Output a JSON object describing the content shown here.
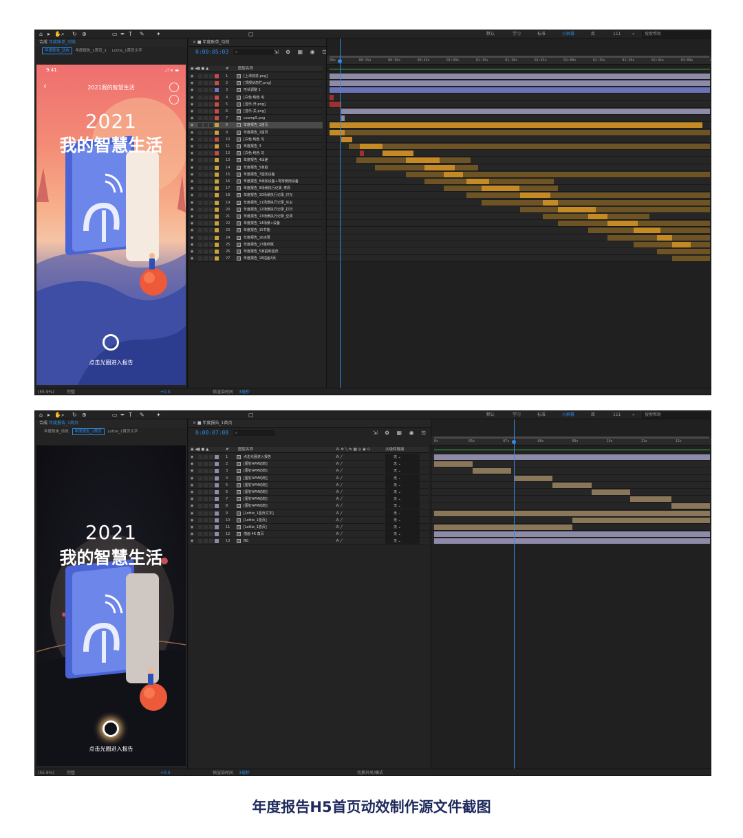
{
  "toolbar": {
    "workspaces": [
      "默认",
      "学习",
      "标准",
      "小屏幕",
      "库",
      "111"
    ],
    "active_workspace": "小屏幕",
    "search_placeholder": "搜索帮助",
    "more": "»"
  },
  "shot1": {
    "panel_title": "合成",
    "panel_comp": "年度账单_动效",
    "breadcrumbs": [
      "年度账单_动效",
      "年度报告_1首页_1",
      "Lottie_1首页文字"
    ],
    "active_crumb": 0,
    "phone": {
      "time": "9:41",
      "signal": "..ıl ᯤ ▬",
      "back": "‹",
      "title": "2021我的智慧生活",
      "year": "2021",
      "headline": "我的智慧生活",
      "cta": "点击光圈进入报告"
    },
    "footer": {
      "zoom": "(55.9%)",
      "quality": "完整",
      "exposure": "+0.0",
      "render_time_label": "帧渲染时间",
      "render_time": "3毫秒"
    },
    "timeline": {
      "tab": "年度账单_动效",
      "timecode": "0:00:05:03",
      "col_layer_name": "图层名称",
      "ticks": [
        "00s",
        "00:15s",
        "00:30s",
        "00:45s",
        "01:00s",
        "01:15s",
        "01:30s",
        "01:45s",
        "02:00s",
        "02:15s",
        "02:30s",
        "02:45s",
        "03:00s",
        "03:15s"
      ],
      "playhead": 0.027,
      "layers": [
        {
          "n": "1",
          "name": "[上滑前进.png]",
          "color": "#c84b4b",
          "icon": "img",
          "bar": [
            0.0,
            1.0
          ],
          "bc": "lav"
        },
        {
          "n": "2",
          "name": "[顶部状态栏.png]",
          "color": "#c84b4b",
          "icon": "img",
          "bar": [
            0.0,
            1.0
          ],
          "bc": "lav"
        },
        {
          "n": "3",
          "name": "形状调整 1",
          "color": "#6e74c8",
          "icon": "shape",
          "bar": [
            0.0,
            1.0
          ],
          "bc": "blue"
        },
        {
          "n": "4",
          "name": "[白色 纯色 4]",
          "color": "#c84b4b",
          "icon": "solid",
          "bar": [
            0.0,
            0.01
          ],
          "bc": "red"
        },
        {
          "n": "5",
          "name": "[音乐-开.png]",
          "color": "#c84b4b",
          "icon": "img",
          "bar": [
            0.0,
            0.03
          ],
          "bc": "red"
        },
        {
          "n": "6",
          "name": "[音乐-关.png]",
          "color": "#c84b4b",
          "icon": "img",
          "bar": [
            0.03,
            1.0
          ],
          "bc": "lav"
        },
        {
          "n": "7",
          "name": "ceamp5.png",
          "color": "#c84b4b",
          "icon": "img",
          "bar": [
            0.03,
            0.04
          ],
          "bc": "lav"
        },
        {
          "n": "8",
          "name": "年度报告_1首页",
          "color": "#c8a23c",
          "icon": "comp",
          "bar": [
            0.0,
            0.98
          ],
          "bc": "gold",
          "sel": true
        },
        {
          "n": "9",
          "name": "年度报告_2首页",
          "color": "#c8a23c",
          "icon": "comp",
          "bar": [
            0.02,
            1.0
          ],
          "bc": "goldd"
        },
        {
          "n": "10",
          "name": "[白色 纯色 3]",
          "color": "#c84b4b",
          "icon": "solid",
          "bar": [
            0.05,
            0.06
          ],
          "bc": "red"
        },
        {
          "n": "11",
          "name": "年度报告_3",
          "color": "#c8a23c",
          "icon": "comp",
          "bar": [
            0.05,
            1.0
          ],
          "bc": "goldd"
        },
        {
          "n": "12",
          "name": "[白色 纯色 2]",
          "color": "#c84b4b",
          "icon": "solid",
          "bar": [
            0.08,
            0.09
          ],
          "bc": "red"
        },
        {
          "n": "13",
          "name": "年度报告_4出差",
          "color": "#c8a23c",
          "icon": "comp",
          "bar": [
            0.07,
            0.37
          ],
          "bc": "goldd"
        },
        {
          "n": "14",
          "name": "年度报告_5家庭",
          "color": "#c8a23c",
          "icon": "comp",
          "bar": [
            0.12,
            0.39
          ],
          "bc": "goldd"
        },
        {
          "n": "15",
          "name": "年度报告_7固定设备",
          "color": "#c8a23c",
          "icon": "comp",
          "bar": [
            0.2,
            1.0
          ],
          "bc": "goldd"
        },
        {
          "n": "16",
          "name": "年度报告_8添加设备+将常使用设备",
          "color": "#c8a23c",
          "icon": "comp",
          "bar": [
            0.25,
            0.59
          ],
          "bc": "goldd"
        },
        {
          "n": "17",
          "name": "年度报告_9场景执行记录_寿辰",
          "color": "#c8a23c",
          "icon": "comp",
          "bar": [
            0.3,
            0.6
          ],
          "bc": "goldd"
        },
        {
          "n": "18",
          "name": "年度报告_10场景执行记录_灯光",
          "color": "#c8a23c",
          "icon": "comp",
          "bar": [
            0.36,
            1.0
          ],
          "bc": "goldd"
        },
        {
          "n": "19",
          "name": "年度报告_11场景执行记录_灰尘",
          "color": "#c8a23c",
          "icon": "comp",
          "bar": [
            0.4,
            1.0
          ],
          "bc": "goldd"
        },
        {
          "n": "20",
          "name": "年度报告_12场景执行记录_打扫",
          "color": "#c8a23c",
          "icon": "comp",
          "bar": [
            0.5,
            1.0
          ],
          "bc": "goldd"
        },
        {
          "n": "21",
          "name": "年度报告_13场景执行记录_空调",
          "color": "#c8a23c",
          "icon": "comp",
          "bar": [
            0.56,
            0.84
          ],
          "bc": "goldd"
        },
        {
          "n": "22",
          "name": "年度报告_14场景+设备",
          "color": "#c8a23c",
          "icon": "comp",
          "bar": [
            0.6,
            1.0
          ],
          "bc": "goldd"
        },
        {
          "n": "23",
          "name": "年度报告_15节能",
          "color": "#c8a23c",
          "icon": "comp",
          "bar": [
            0.68,
            1.0
          ],
          "bc": "goldd"
        },
        {
          "n": "24",
          "name": "年度报告_16点赞",
          "color": "#c8a23c",
          "icon": "comp",
          "bar": [
            0.73,
            1.0
          ],
          "bc": "goldd"
        },
        {
          "n": "25",
          "name": "年度报告_17最终赋",
          "color": "#c8a23c",
          "icon": "comp",
          "bar": [
            0.8,
            1.0
          ],
          "bc": "goldd"
        },
        {
          "n": "26",
          "name": "年度报告_5家庭和首页",
          "color": "#c8a23c",
          "icon": "comp",
          "bar": [
            0.86,
            1.0
          ],
          "bc": "goldd"
        },
        {
          "n": "27",
          "name": "年度报告_18插画3页",
          "color": "#c8a23c",
          "icon": "comp",
          "bar": [
            0.9,
            1.0
          ],
          "bc": "goldd"
        }
      ],
      "gold_segments": [
        [
          0.0,
          0.04
        ],
        [
          0.03,
          0.06
        ],
        [
          0.08,
          0.14
        ],
        [
          0.14,
          0.22
        ],
        [
          0.2,
          0.29
        ],
        [
          0.25,
          0.33
        ],
        [
          0.3,
          0.35
        ],
        [
          0.36,
          0.42
        ],
        [
          0.4,
          0.5
        ],
        [
          0.5,
          0.58
        ],
        [
          0.56,
          0.6
        ],
        [
          0.6,
          0.7
        ],
        [
          0.68,
          0.73
        ],
        [
          0.73,
          0.81
        ],
        [
          0.8,
          0.87
        ],
        [
          0.86,
          0.9
        ],
        [
          0.9,
          0.95
        ]
      ]
    }
  },
  "shot2": {
    "panel_title": "合成",
    "panel_comp": "年度报告_1首页",
    "breadcrumbs": [
      "年度账单_动效",
      "年度报告_1首页",
      "Lottie_1首页文字"
    ],
    "active_crumb": 1,
    "phone": {
      "year": "2021",
      "headline": "我的智慧生活",
      "cta": "点击光圈进入报告"
    },
    "footer": {
      "zoom": "(55.9%)",
      "quality": "完整",
      "exposure": "+0.0",
      "render_time_label": "帧渲染时间",
      "render_time": "3毫秒",
      "switch_mode": "切换开关/模式"
    },
    "timeline": {
      "tab": "年度报告_1首页",
      "timecode": "0:00:07:08",
      "col_layer_name": "图层名称",
      "col_parent": "父级和链接",
      "ticks": [
        "0s",
        "05s",
        "07s",
        "08s",
        "09s",
        "10s",
        "11s",
        "12s",
        "13s"
      ],
      "playhead": 0.29,
      "parent_value": "无",
      "layers": [
        {
          "n": "1",
          "name": "点击光圈进入报告",
          "color": "#8d8ba8",
          "icon": "text",
          "bar": [
            0.0,
            1.0
          ],
          "bc": "lav"
        },
        {
          "n": "2",
          "name": "[图钉APM动效]",
          "color": "#8d8ba8",
          "icon": "comp",
          "bar": [
            0.0,
            0.14
          ],
          "bc": "tan"
        },
        {
          "n": "3",
          "name": "[图钉APM动效]",
          "color": "#8d8ba8",
          "icon": "comp",
          "bar": [
            0.14,
            0.28
          ],
          "bc": "tan"
        },
        {
          "n": "4",
          "name": "[图钉APM动效]",
          "color": "#8d8ba8",
          "icon": "comp",
          "bar": [
            0.29,
            0.43
          ],
          "bc": "tan"
        },
        {
          "n": "5",
          "name": "[图钉APM动效]",
          "color": "#8d8ba8",
          "icon": "comp",
          "bar": [
            0.43,
            0.57
          ],
          "bc": "tan"
        },
        {
          "n": "6",
          "name": "[图钉APM动效]",
          "color": "#8d8ba8",
          "icon": "comp",
          "bar": [
            0.57,
            0.71
          ],
          "bc": "tan"
        },
        {
          "n": "7",
          "name": "[图钉APM动效]",
          "color": "#8d8ba8",
          "icon": "comp",
          "bar": [
            0.71,
            0.86
          ],
          "bc": "tan"
        },
        {
          "n": "8",
          "name": "[图钉APM动效]",
          "color": "#8d8ba8",
          "icon": "comp",
          "bar": [
            0.86,
            1.0
          ],
          "bc": "tan"
        },
        {
          "n": "9",
          "name": "[Lottie_1首页文字]",
          "color": "#8d8ba8",
          "icon": "comp",
          "bar": [
            0.0,
            1.0
          ],
          "bc": "tan"
        },
        {
          "n": "10",
          "name": "[Lottie_1首页]",
          "color": "#8d8ba8",
          "icon": "comp",
          "bar": [
            0.5,
            1.0
          ],
          "bc": "tan"
        },
        {
          "n": "11",
          "name": "[Lottie_1首页]",
          "color": "#8d8ba8",
          "icon": "comp",
          "bar": [
            0.0,
            0.5
          ],
          "bc": "tan"
        },
        {
          "n": "12",
          "name": "插画 4K 角页",
          "color": "#8d8ba8",
          "icon": "img",
          "bar": [
            0.0,
            1.0
          ],
          "bc": "lav"
        },
        {
          "n": "13",
          "name": "BG",
          "color": "#8d8ba8",
          "icon": "img",
          "bar": [
            0.0,
            1.0
          ],
          "bc": "lav"
        }
      ]
    }
  },
  "caption": "年度报告H5首页动效制作源文件截图"
}
